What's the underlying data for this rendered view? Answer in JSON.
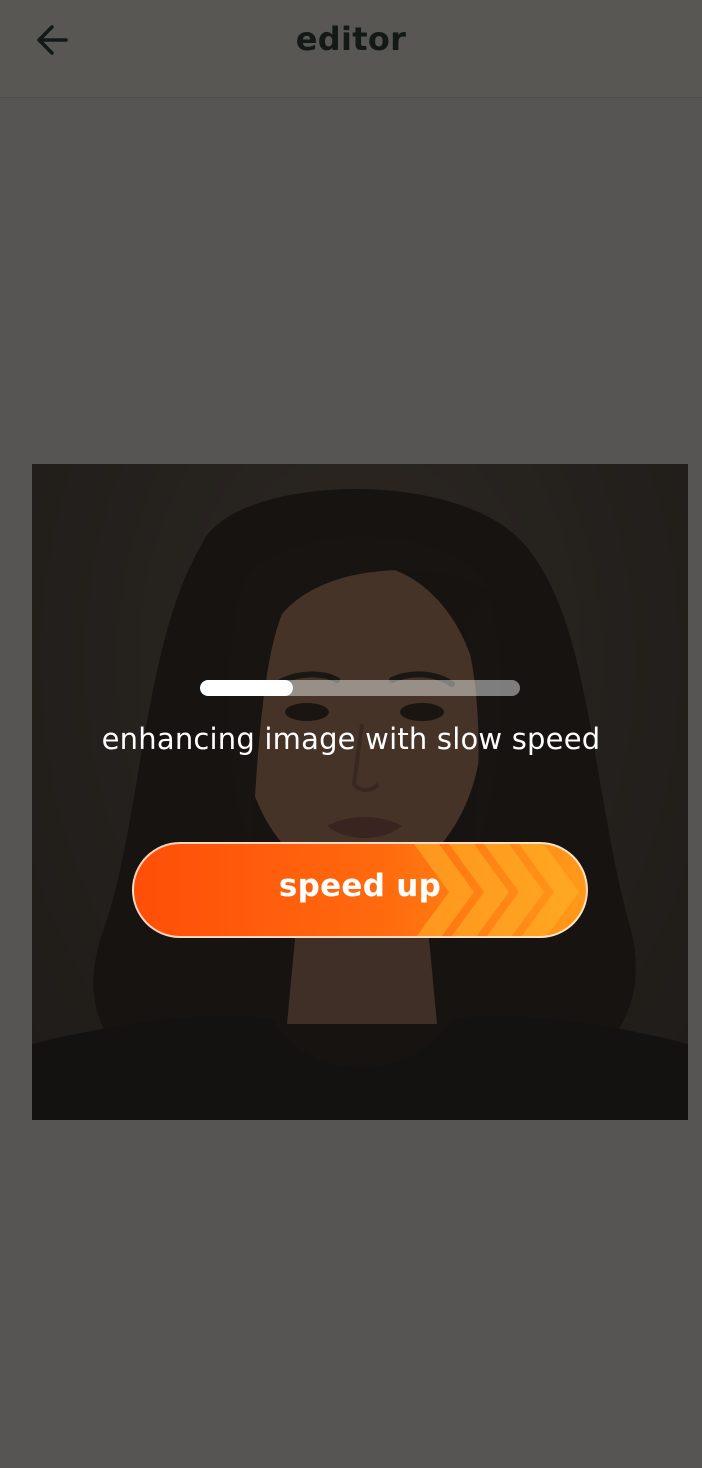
{
  "appbar": {
    "title": "editor",
    "back_icon": "arrow-left-icon"
  },
  "photo": {
    "subject": "portrait-photo"
  },
  "loading": {
    "progress_fraction": 0.29,
    "status": "enhancing image with slow speed",
    "speed_up_label": "speed up"
  },
  "colors": {
    "accent_start": "#ff4e08",
    "accent_end": "#ff9a1a",
    "title_color": "#132a2a"
  }
}
